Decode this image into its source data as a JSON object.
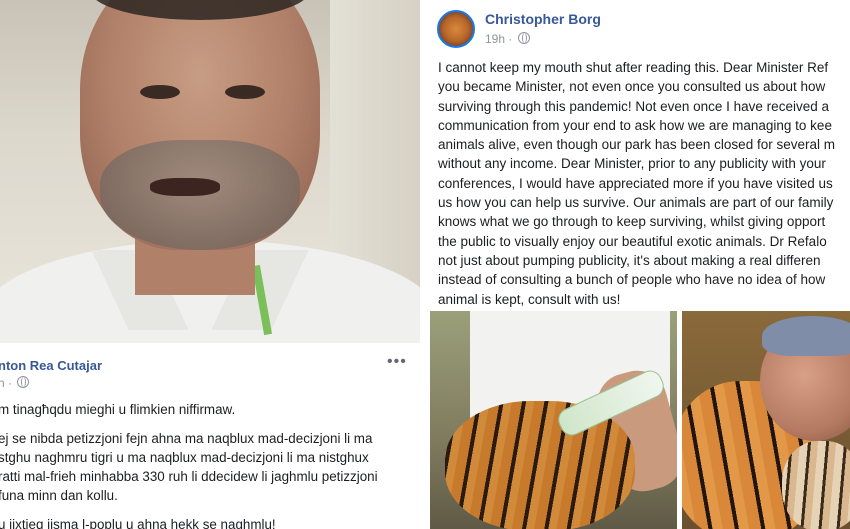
{
  "left_post": {
    "author": "nton Rea Cutajar",
    "time": "h ·",
    "more_label": "•••",
    "paragraphs": [
      "m tinagħqdu mieghi u flimkien niffirmaw.",
      "ej se nibda petizzjoni fejn ahna ma naqblux mad-decizjoni li ma\nstghu naghmru tigri u ma naqblux mad-decizjoni li ma nistghux\nratti mal-frieh minhabba 330 ruh li ddecidew li jaghmlu petizzjoni\nfuna minn dan kollu.",
      "u jixtieq jisma l-poplu u ahna hekk se naghmlu!"
    ]
  },
  "right_post": {
    "author": "Christopher Borg",
    "time": "19h ·",
    "body": "I cannot keep my mouth shut after reading this. Dear Minister Ref\nyou became Minister, not even once you consulted us about how\nsurviving through this pandemic! Not even once I have received a\ncommunication from your end to ask how we are managing to kee\nanimals alive, even though our park has been closed for several m\nwithout any income. Dear Minister, prior to any publicity with your\nconferences, I would have appreciated more if you have visited us\nus how you can help us survive. Our animals are part of our family\nknows what we go through to keep surviving, whilst giving opport\nthe public to visually enjoy our beautiful exotic animals. Dr Refalo\nnot just about pumping publicity, it's about making a real differen\ninstead of consulting a bunch of people who have no idea of how\nanimal is kept, consult with us!"
  },
  "icons": {
    "privacy": "globe-icon",
    "more": "more-options-icon",
    "avatar": "profile-avatar"
  },
  "colors": {
    "author_link": "#385898",
    "meta_gray": "#90949c",
    "text": "#1c1e21"
  }
}
